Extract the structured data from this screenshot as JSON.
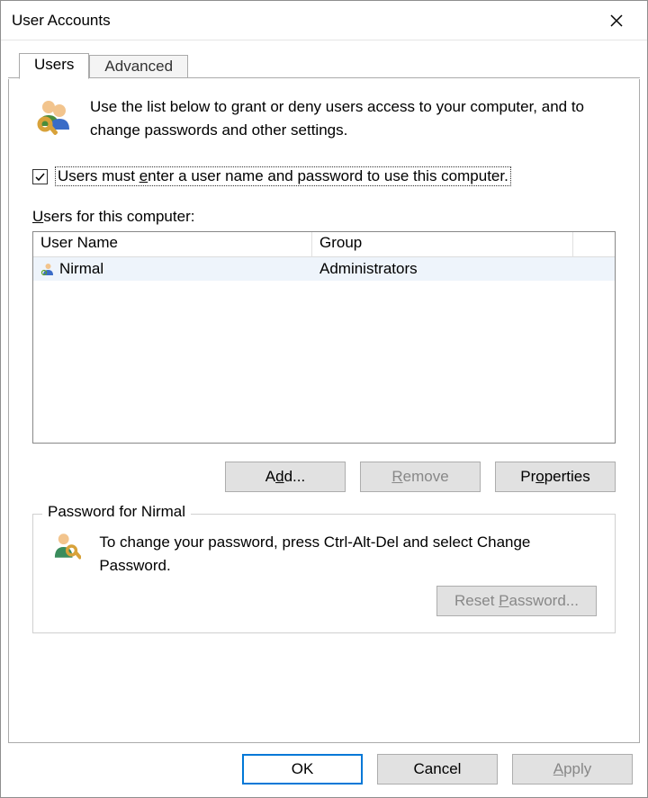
{
  "window": {
    "title": "User Accounts"
  },
  "tabs": {
    "users": "Users",
    "advanced": "Advanced"
  },
  "intro_text": "Use the list below to grant or deny users access to your computer, and to change passwords and other settings.",
  "checkbox": {
    "checked": true,
    "label_before_underline": "Users must ",
    "label_underline": "e",
    "label_after_underline": "nter a user name and password to use this computer."
  },
  "users_section": {
    "label_underline": "U",
    "label_rest": "sers for this computer:",
    "headers": {
      "col1": "User Name",
      "col2": "Group"
    },
    "rows": [
      {
        "username": "Nirmal",
        "group": "Administrators"
      }
    ]
  },
  "buttons": {
    "add_before": "A",
    "add_under": "d",
    "add_after": "d...",
    "remove_under": "R",
    "remove_after": "emove",
    "properties_before": "Pr",
    "properties_under": "o",
    "properties_after": "perties"
  },
  "password_section": {
    "legend": "Password for Nirmal",
    "text": "To change your password, press Ctrl-Alt-Del and select Change Password.",
    "reset_before": "Reset ",
    "reset_under": "P",
    "reset_after": "assword..."
  },
  "footer": {
    "ok": "OK",
    "cancel": "Cancel",
    "apply_under": "A",
    "apply_after": "pply"
  }
}
